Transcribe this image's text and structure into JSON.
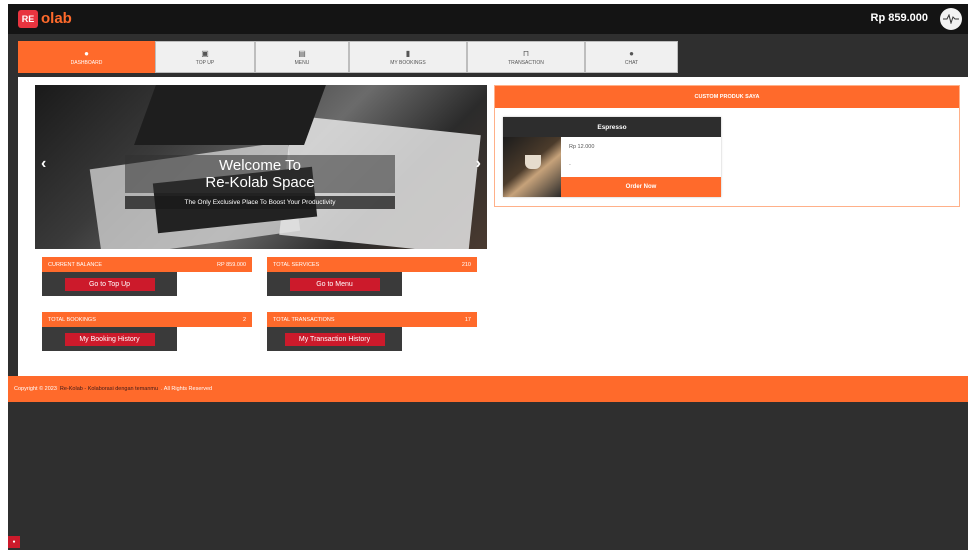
{
  "header": {
    "logo_text": "olab",
    "logo_mark": "RE",
    "balance": "Rp 859.000",
    "avatar_icon": "avatar-icon"
  },
  "tabs": [
    {
      "label": "DASHBOARD",
      "icon": "dashboard-icon",
      "glyph": "●",
      "active": true
    },
    {
      "label": "TOP UP",
      "icon": "topup-icon",
      "glyph": "▣",
      "active": false
    },
    {
      "label": "MENU",
      "icon": "menu-icon",
      "glyph": "▤",
      "active": false
    },
    {
      "label": "MY BOOKINGS",
      "icon": "bookmark-icon",
      "glyph": "▮",
      "active": false
    },
    {
      "label": "TRANSACTION",
      "icon": "cart-icon",
      "glyph": "⊓",
      "active": false
    },
    {
      "label": "CHAT",
      "icon": "chat-icon",
      "glyph": "●",
      "active": false
    }
  ],
  "hero": {
    "title_line1": "Welcome To",
    "title_line2": "Re-Kolab Space",
    "subtitle": "The Only Exclusive Place To Boost Your Productivity",
    "prev": "‹",
    "next": "›"
  },
  "cards": {
    "balance": {
      "label": "CURRENT BALANCE",
      "value": "RP 859.000",
      "button": "Go to Top Up"
    },
    "services": {
      "label": "TOTAL SERVICES",
      "value": "210",
      "button": "Go to Menu"
    },
    "bookings": {
      "label": "TOTAL BOOKINGS",
      "value": "2",
      "button": "My Booking History"
    },
    "transactions": {
      "label": "TOTAL TRANSACTIONS",
      "value": "17",
      "button": "My Transaction History"
    }
  },
  "custom": {
    "title": "CUSTOM PRODUK SAYA",
    "product": {
      "name": "Espresso",
      "price": "Rp 12.000",
      "desc": "-",
      "button": "Order Now"
    }
  },
  "footer": {
    "prefix": "Copyright © 2023",
    "brand": "Re-Kolab - Kolaborasi dengan temanmu",
    "suffix": ". All Rights Reserved"
  },
  "colors": {
    "accent": "#ff6a2b",
    "button_red": "#cc1a2b",
    "dark": "#2f2f2f"
  }
}
